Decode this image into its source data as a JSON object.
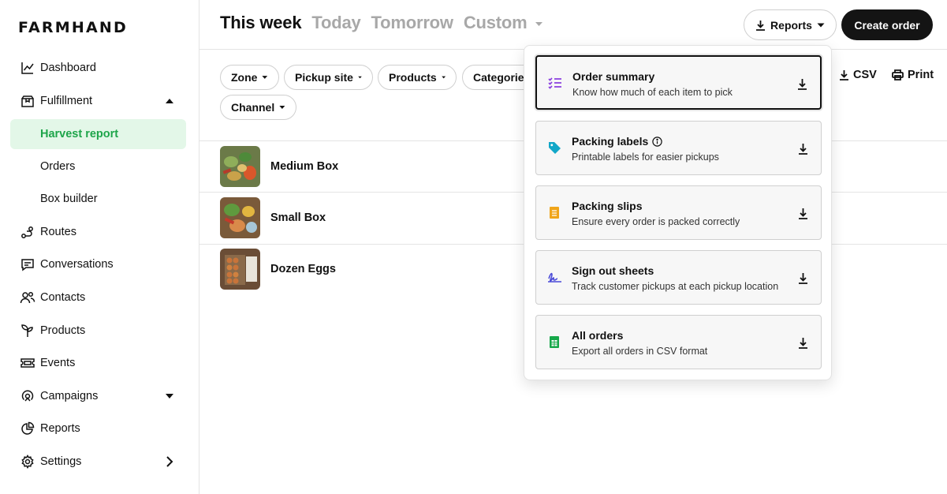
{
  "brand": "FARMHAND",
  "sidebar": {
    "items": [
      {
        "label": "Dashboard",
        "icon": "dashboard-chart-icon"
      },
      {
        "label": "Fulfillment",
        "icon": "box-icon",
        "caret": "up"
      },
      {
        "label": "Harvest report",
        "sub": true,
        "active": true
      },
      {
        "label": "Orders",
        "sub": true
      },
      {
        "label": "Box builder",
        "sub": true
      },
      {
        "label": "Routes",
        "icon": "route-icon"
      },
      {
        "label": "Conversations",
        "icon": "chat-icon"
      },
      {
        "label": "Contacts",
        "icon": "contacts-icon"
      },
      {
        "label": "Products",
        "icon": "sprout-icon"
      },
      {
        "label": "Events",
        "icon": "ticket-icon"
      },
      {
        "label": "Campaigns",
        "icon": "campaign-icon",
        "caret": "down"
      },
      {
        "label": "Reports",
        "icon": "pie-chart-icon"
      },
      {
        "label": "Settings",
        "icon": "gear-icon",
        "caret": "right"
      }
    ]
  },
  "header": {
    "tabs": [
      {
        "label": "This week",
        "active": true
      },
      {
        "label": "Today"
      },
      {
        "label": "Tomorrow"
      },
      {
        "label": "Custom"
      }
    ],
    "reports_label": "Reports",
    "create_order_label": "Create order"
  },
  "filters": {
    "chips": [
      "Zone",
      "Pickup site",
      "Products",
      "Categories",
      "Channel"
    ],
    "csv_label": "CSV",
    "print_label": "Print"
  },
  "products": [
    {
      "name": "Medium Box"
    },
    {
      "name": "Small Box"
    },
    {
      "name": "Dozen Eggs"
    }
  ],
  "reports_menu": {
    "items": [
      {
        "title": "Order summary",
        "desc": "Know how much of each item to pick",
        "icon": "checklist-icon",
        "color": "#8b3fe0"
      },
      {
        "title": "Packing labels",
        "desc": "Printable labels for easier pickups",
        "icon": "tag-icon",
        "color": "#12a7c8",
        "info": true
      },
      {
        "title": "Packing slips",
        "desc": "Ensure every order is packed correctly",
        "icon": "document-icon",
        "color": "#f0a51a"
      },
      {
        "title": "Sign out sheets",
        "desc": "Track customer pickups at each pickup location",
        "icon": "signature-icon",
        "color": "#4a4ad8"
      },
      {
        "title": "All orders",
        "desc": "Export all orders in CSV format",
        "icon": "spreadsheet-icon",
        "color": "#17a84a"
      }
    ]
  },
  "colors": {
    "accent_green": "#1ea54a",
    "active_bg": "#e3f7e8",
    "primary_button": "#141414"
  }
}
